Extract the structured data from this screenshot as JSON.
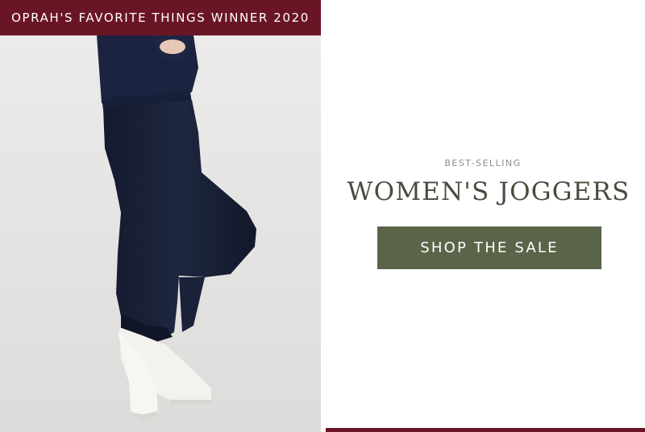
{
  "banner": {
    "text": "OPRAH'S FAVORITE THINGS WINNER 2020"
  },
  "promo": {
    "eyebrow": "BEST-SELLING",
    "headline": "WOMEN'S JOGGERS",
    "cta_label": "SHOP THE SALE"
  },
  "colors": {
    "banner_bg": "#6a1526",
    "cta_bg": "#5a6448",
    "headline": "#4a4a3e",
    "joggers": "#1a2239"
  }
}
